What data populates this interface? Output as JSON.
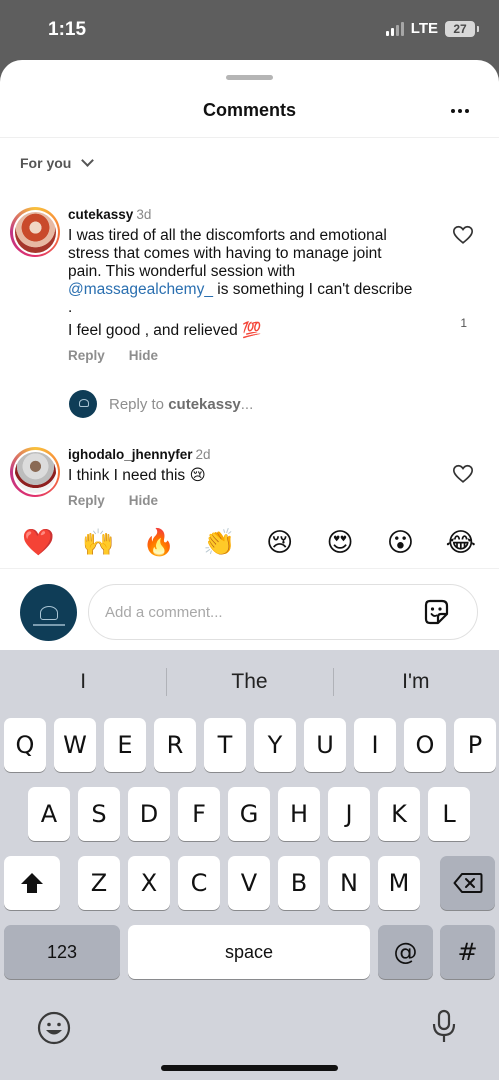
{
  "status": {
    "time": "1:15",
    "network": "LTE",
    "battery": "27"
  },
  "header": {
    "title": "Comments"
  },
  "filter": {
    "label": "For you"
  },
  "comments": [
    {
      "username": "cutekassy",
      "time": "3d",
      "text_before": "I was tired of all the discomforts and emotional stress that comes with having to manage joint pain. This wonderful session with ",
      "mention": "@massagealchemy_",
      "text_after": "  is something I can't describe .",
      "text_line2": "I feel good , and relieved 💯",
      "likes": "1",
      "reply_label": "Reply",
      "hide_label": "Hide"
    },
    {
      "username": "ighodalo_jhennyfer",
      "time": "2d",
      "text": "I think I need this 😢",
      "reply_label": "Reply",
      "hide_label": "Hide"
    }
  ],
  "reply_prompt": {
    "prefix": "Reply to ",
    "username": "cutekassy",
    "suffix": "..."
  },
  "emoji_bar": [
    "❤️",
    "🙌",
    "🔥",
    "👏",
    "😢",
    "😍",
    "😮",
    "😂"
  ],
  "composer": {
    "placeholder": "Add a comment..."
  },
  "keyboard": {
    "suggestions": [
      "I",
      "The",
      "I'm"
    ],
    "row1": [
      "Q",
      "W",
      "E",
      "R",
      "T",
      "Y",
      "U",
      "I",
      "O",
      "P"
    ],
    "row2": [
      "A",
      "S",
      "D",
      "F",
      "G",
      "H",
      "J",
      "K",
      "L"
    ],
    "row3": [
      "Z",
      "X",
      "C",
      "V",
      "B",
      "N",
      "M"
    ],
    "numbers_key": "123",
    "space_key": "space",
    "at_key": "@",
    "hash_key": "#"
  },
  "icons": {
    "shift": "shift-arrow-icon",
    "delete": "backspace-icon",
    "emoji": "emoji-face-icon",
    "mic": "microphone-icon"
  }
}
